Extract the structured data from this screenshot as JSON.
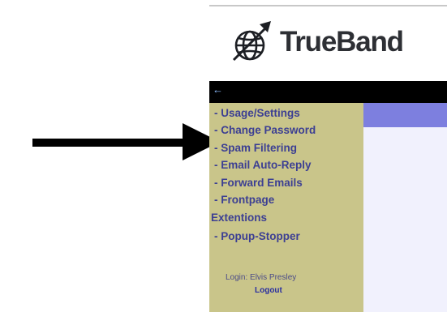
{
  "logo": {
    "text": "TrueBand"
  },
  "sidebar": {
    "items": [
      {
        "label": "- Usage/Settings"
      },
      {
        "label": "- Change Password"
      },
      {
        "label": "- Spam Filtering"
      },
      {
        "label": "- Email Auto-Reply"
      },
      {
        "label": "- Forward Emails"
      },
      {
        "label": "- Frontpage"
      },
      {
        "label": "Extentions"
      },
      {
        "label": "- Popup-Stopper"
      }
    ],
    "login_text": "Login: Elvis Presley",
    "logout_label": "Logout"
  },
  "colors": {
    "sidebar_bg": "#c9c58a",
    "link": "#3c3f93",
    "header_bar": "#000000",
    "content_strip": "#7d7fdf",
    "content_bg": "#f1f1fd"
  }
}
